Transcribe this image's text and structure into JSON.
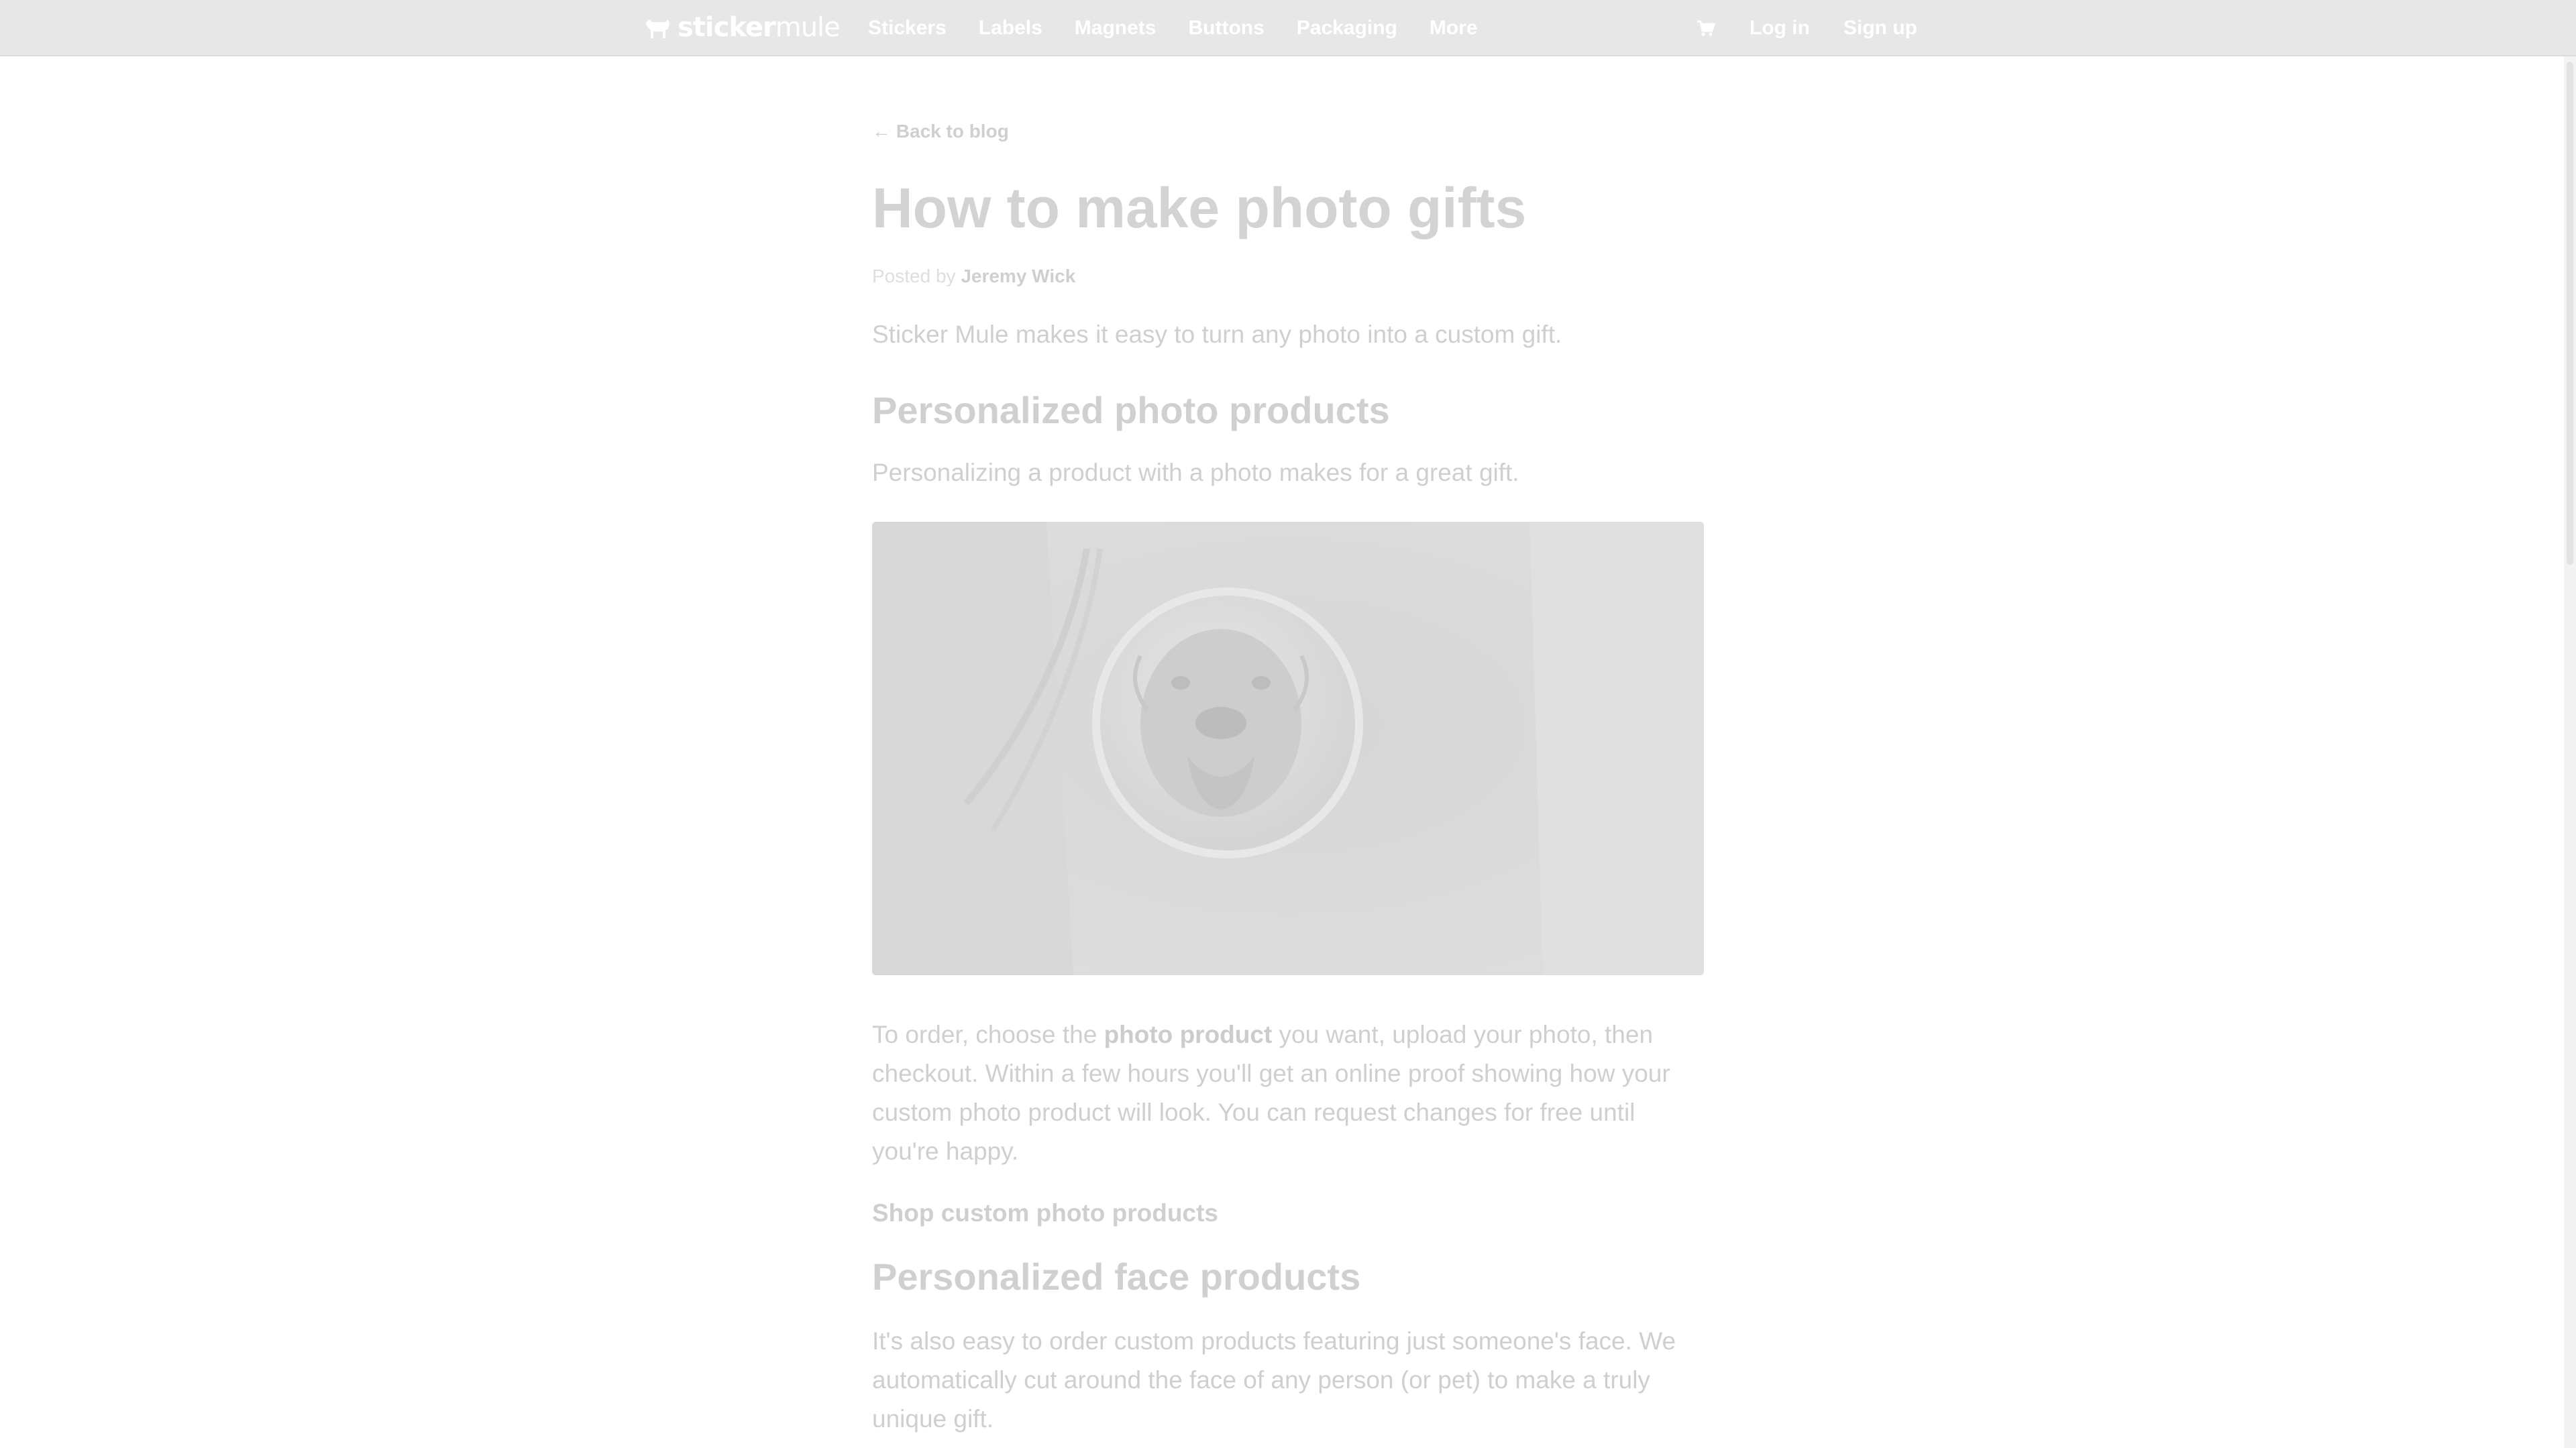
{
  "brand": {
    "name_bold": "sticker",
    "name_light": "mule"
  },
  "nav": {
    "items": [
      "Stickers",
      "Labels",
      "Magnets",
      "Buttons",
      "Packaging",
      "More"
    ],
    "cart": "cart-icon",
    "login": "Log in",
    "signup": "Sign up"
  },
  "article": {
    "back_link": "← Back to blog",
    "title": "How to make photo gifts",
    "byline_prefix": "Posted by",
    "author": "Jeremy Wick",
    "intro": "Sticker Mule makes it easy to turn any photo into a custom gift.",
    "section1": {
      "heading": "Personalized photo products",
      "text": "Personalizing a product with a photo makes for a great gift."
    },
    "order_paragraph": {
      "prefix": "To order, choose the ",
      "link": "photo product",
      "suffix": " you want, upload your photo, then checkout. Within a few hours you'll get an online proof showing how your custom photo product will look. You can request changes for free until you're happy."
    },
    "shop_link": "Shop custom photo products",
    "section2": {
      "heading": "Personalized face products",
      "text": "It's also easy to order custom products featuring just someone's face. We automatically cut around the face of any person (or pet) to make a truly unique gift."
    }
  }
}
